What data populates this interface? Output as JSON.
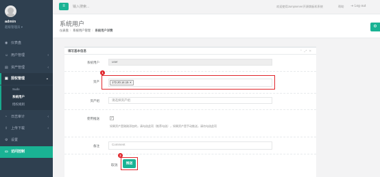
{
  "sidebar": {
    "user_name": "admin",
    "user_role": "超级管理员 ▾",
    "items": [
      {
        "icon": "◉",
        "label": "仪表盘",
        "chevron": ""
      },
      {
        "icon": "☺",
        "label": "用户管理",
        "chevron": "‹"
      },
      {
        "icon": "▤",
        "label": "资产管理",
        "chevron": "‹"
      },
      {
        "icon": "▣",
        "label": "授权管理",
        "chevron": "⌄"
      },
      {
        "icon": "◔",
        "label": "日志审计",
        "chevron": "‹"
      },
      {
        "icon": "⇪",
        "label": "上传下载",
        "chevron": "‹"
      },
      {
        "icon": "⚙",
        "label": "设置",
        "chevron": ""
      },
      {
        "icon": "▭",
        "label": "访问控制",
        "chevron": ""
      }
    ],
    "subitems": [
      "Sudo",
      "系统用户",
      "授权规则"
    ]
  },
  "topbar": {
    "menu_icon": "≡",
    "search_placeholder": "输入搜索...",
    "welcome": "欢迎使用Jumpserver开源跳板机系统",
    "help": "帮助",
    "logout": "Log out"
  },
  "heading": {
    "title": "系统用户",
    "crumbs": [
      "仪表盘",
      "系统用户管理",
      "系统用户详情"
    ]
  },
  "panel": {
    "title": "填写基本信息",
    "tools": "⌃ ⤢ ✕",
    "fields": {
      "sysuser_label": "系统用户",
      "sysuser_value": "user",
      "asset_label": "资产",
      "asset_chip": "172.20.14.15 ✕",
      "group_label": "资产组",
      "group_placeholder": "请选择资产组",
      "push_label": "使用推送",
      "push_help": "如果资产是刚刚添加的，请勾选此项（推荐勾选），如果资产是手动推送，请勿勾选此项",
      "comment_label": "备注",
      "comment_placeholder": "Comment"
    },
    "cancel": "取消",
    "submit": "推送",
    "markers": [
      "1",
      "2"
    ]
  },
  "colors": {
    "sidebar": "#2f4050",
    "accent": "#1ab394",
    "highlight": "#e0242a"
  }
}
